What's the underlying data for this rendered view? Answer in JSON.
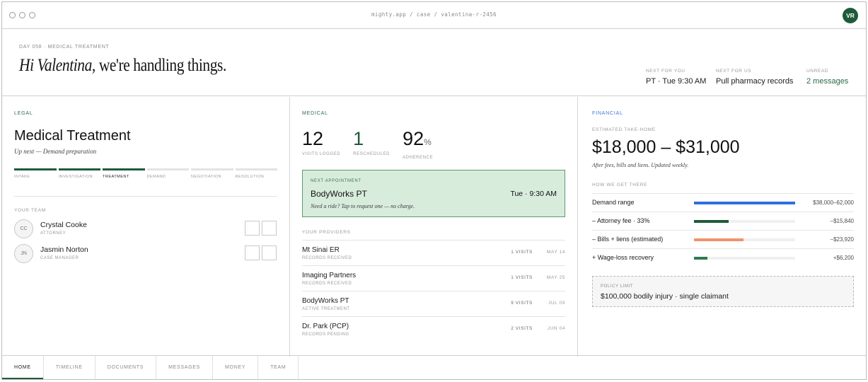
{
  "browser": {
    "url": "mighty.app / case / valentina-r-2456",
    "avatar_initials": "VR"
  },
  "header": {
    "eyebrow": "DAY 058 · MEDICAL TREATMENT",
    "greeting_name": "Hi Valentina,",
    "greeting_rest": " we're handling things.",
    "stats": [
      {
        "label": "NEXT FOR YOU",
        "value": "PT · Tue 9:30 AM"
      },
      {
        "label": "NEXT FOR US",
        "value": "Pull pharmacy records"
      },
      {
        "label": "UNREAD",
        "value": "2 messages"
      }
    ]
  },
  "legal": {
    "section_label": "LEGAL",
    "stage": "Medical Treatment",
    "up_next": "Up next — Demand preparation",
    "steps": [
      {
        "label": "INTAKE",
        "status": "done"
      },
      {
        "label": "INVESTIGATION",
        "status": "done"
      },
      {
        "label": "TREATMENT",
        "status": "current"
      },
      {
        "label": "DEMAND",
        "status": "todo"
      },
      {
        "label": "NEGOTIATION",
        "status": "todo"
      },
      {
        "label": "RESOLUTION",
        "status": "todo"
      }
    ],
    "team_label": "YOUR TEAM",
    "team": [
      {
        "initials": "CC",
        "name": "Crystal Cooke",
        "role": "ATTORNEY"
      },
      {
        "initials": "JN",
        "name": "Jasmin Norton",
        "role": "CASE MANAGER"
      }
    ]
  },
  "medical": {
    "section_label": "MEDICAL",
    "stats": [
      {
        "value": "12",
        "unit": "",
        "label": "VISITS LOGGED"
      },
      {
        "value": "1",
        "unit": "",
        "label": "RESCHEDULED"
      },
      {
        "value": "92",
        "unit": "%",
        "label": "ADHERENCE"
      }
    ],
    "appointment": {
      "label": "NEXT APPOINTMENT",
      "name": "BodyWorks PT",
      "time": "Tue · 9:30 AM",
      "hint": "Need a ride? Tap to request one — no charge."
    },
    "providers_label": "YOUR PROVIDERS",
    "providers": [
      {
        "name": "Mt Sinai ER",
        "status": "RECORDS RECEIVED",
        "visits": "1 VISITS",
        "date": "MAY 14"
      },
      {
        "name": "Imaging Partners",
        "status": "RECORDS RECEIVED",
        "visits": "1 VISITS",
        "date": "MAY 25"
      },
      {
        "name": "BodyWorks PT",
        "status": "ACTIVE TREATMENT",
        "visits": "9 VISITS",
        "date": "JUL 09"
      },
      {
        "name": "Dr. Park (PCP)",
        "status": "RECORDS PENDING",
        "visits": "2 VISITS",
        "date": "JUN 04"
      }
    ]
  },
  "financial": {
    "section_label": "FINANCIAL",
    "estimate_label": "ESTIMATED TAKE-HOME",
    "range": "$18,000 – $31,000",
    "note": "After fees, bills and liens. Updated weekly.",
    "how_label": "HOW WE GET THERE",
    "breakdown": [
      {
        "label": "Demand range",
        "value": "$38,000–62,000",
        "fill": 1.0,
        "color": "#2d6fe0"
      },
      {
        "label": "– Attorney fee · 33%",
        "value": "–$15,840",
        "fill": 0.34,
        "color": "#1f5a3a"
      },
      {
        "label": "– Bills + liens (estimated)",
        "value": "–$23,920",
        "fill": 0.49,
        "color": "#f0926d"
      },
      {
        "label": "+ Wage-loss recovery",
        "value": "+$6,200",
        "fill": 0.13,
        "color": "#2e7a4f"
      }
    ],
    "policy_label": "POLICY LIMIT",
    "policy_value": "$100,000 bodily injury · single claimant"
  },
  "nav": {
    "tabs": [
      "HOME",
      "TIMELINE",
      "DOCUMENTS",
      "MESSAGES",
      "MONEY",
      "TEAM"
    ],
    "active": "HOME"
  },
  "colors": {
    "brand_green": "#1f5a3a",
    "financial_blue": "#3b78d8",
    "appointment_bg": "#d8ecdc"
  }
}
